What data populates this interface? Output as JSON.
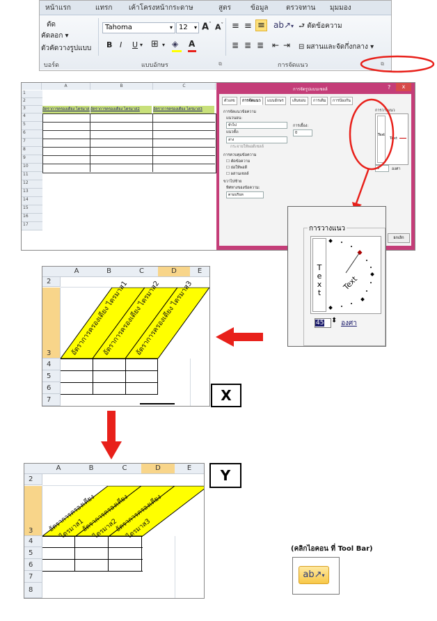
{
  "ribbon": {
    "tabs": [
      "หน้าแรก",
      "แทรก",
      "เค้าโครงหน้ากระดาษ",
      "สูตร",
      "ข้อมูล",
      "ตรวจทาน",
      "มุมมอง"
    ],
    "clipboard": {
      "cut": "ตัด",
      "copy": "คัดลอก",
      "format_painter": "ตัวคัดวางรูปแบบ",
      "group": "บอร์ด"
    },
    "font": {
      "name": "Tahoma",
      "size": "12",
      "bold": "B",
      "italic": "I",
      "underline": "U",
      "group": "แบบอักษร",
      "font_color_letter": "A"
    },
    "alignment": {
      "wrap_text": "ตัดข้อความ",
      "merge_center": "ผสานและจัดกึ่งกลาง",
      "group": "การจัดแนว"
    }
  },
  "sheet_small": {
    "columns": [
      "A",
      "B",
      "C"
    ],
    "rows": [
      "1",
      "2",
      "3",
      "4",
      "5",
      "6",
      "7",
      "8",
      "9",
      "10",
      "11",
      "12",
      "13",
      "14",
      "15",
      "16",
      "17"
    ],
    "headers": [
      "อัตราการครองเตียง ไตรมาส1",
      "อัตราการครองเตียง ไตรมาส2",
      "อัตราการครองเตียง ไตรมาส3"
    ]
  },
  "format_dialog": {
    "title": "การจัดรูปแบบเซลล์",
    "help": "?",
    "close": "x",
    "tabs": [
      "ตัวเลข",
      "การจัดแนว",
      "แบบอักษร",
      "เส้นขอบ",
      "การเติม",
      "การป้องกัน"
    ],
    "section_alignment": "การจัดแนวข้อความ",
    "horizontal_label": "แนวนอน:",
    "horizontal_value": "ทั่วไป",
    "vertical_label": "แนวตั้ง:",
    "vertical_value": "ล่าง",
    "indent_label": "การเยื้อง:",
    "indent_value": "0",
    "justify_distributed": "กระจายให้พอดีเซลล์",
    "section_control": "การควบคุมข้อความ",
    "wrap": "ตัดข้อความ",
    "shrink": "ย่อให้พอดี",
    "merge": "ผสานเซลล์",
    "section_rtl": "ขวาไปซ้าย",
    "direction_label": "ทิศทางของข้อความ:",
    "direction_value": "ตามบริบท",
    "orientation": "การวางแนว",
    "text_vertical": "Text",
    "text_diag": "Text",
    "degree_value": "0",
    "degree_label": "องศา",
    "cancel": "ยกเลิก"
  },
  "zoom_dialog": {
    "orientation": "การวางแนว",
    "text_vertical": "Text",
    "text_diag": "Text",
    "degree_value": "45",
    "degree_label": "องศา"
  },
  "sheet_x": {
    "columns": [
      "A",
      "B",
      "C",
      "D",
      "E"
    ],
    "rows": [
      "2",
      "3",
      "4",
      "5",
      "6",
      "7"
    ],
    "headers": [
      "อัตราการครองเตียง ไตรมาส1",
      "อัตราการครองเตียง ไตรมาส2",
      "อัตราการครองเตียง ไตรมาส3"
    ],
    "label": "X"
  },
  "sheet_y": {
    "columns": [
      "A",
      "B",
      "C",
      "D",
      "E"
    ],
    "rows": [
      "2",
      "3",
      "4",
      "5",
      "6",
      "7",
      "8"
    ],
    "headers_line1": [
      "อัตราการครองเตียง",
      "อัตราการครองเตียง",
      "อัตราการครองเตียง"
    ],
    "headers_line2": [
      "ไตรมาส1",
      "ไตรมาส2",
      "ไตรมาส3"
    ],
    "label": "Y"
  },
  "hint": {
    "text": "(คลิกไอคอน ที่ Tool Bar)"
  },
  "colors": {
    "highlight_yellow": "#ffff00",
    "annotation_red": "#e8201a",
    "dialog_pink": "#c43d78"
  }
}
